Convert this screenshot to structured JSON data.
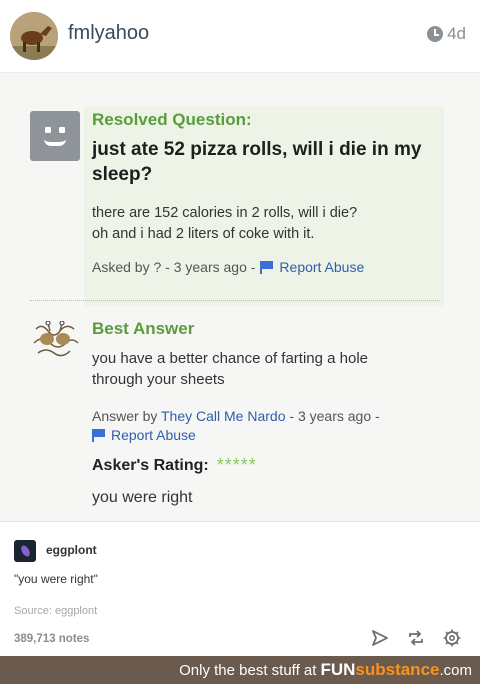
{
  "header": {
    "username": "fmlyahoo",
    "time": "4d",
    "avatar_icon": "horse-avatar"
  },
  "question": {
    "heading": "Resolved Question:",
    "title": "just ate 52 pizza rolls, will i die in my sleep?",
    "body_line1": "there are 152 calories in 2 rolls, will i die?",
    "body_line2": "oh and i had 2 liters of coke with it.",
    "asked_text": "Asked by ? - 3 years ago -",
    "report_label": "Report Abuse",
    "heading_color": "#5a9c3c"
  },
  "answer": {
    "heading": "Best Answer",
    "body_line1": "you have a better chance of farting a hole",
    "body_line2": "through your sheets",
    "answer_prefix": "Answer by ",
    "answerer": "They Call Me Nardo",
    "answer_suffix": " - 3 years ago -",
    "report_label": "Report Abuse",
    "rating_label": "Asker's Rating:",
    "stars": "*****",
    "rating_value": 5,
    "rating_comment": "you were right"
  },
  "reblog": {
    "name": "eggplont",
    "quote": "\"you were right\"",
    "source": "Source: eggplont",
    "notes": "389,713 notes"
  },
  "footer": {
    "text": "Only the best stuff at",
    "brand_a": "FUN",
    "brand_b": "substance",
    "brand_c": ".com",
    "bg_color": "#6b5a4e"
  }
}
